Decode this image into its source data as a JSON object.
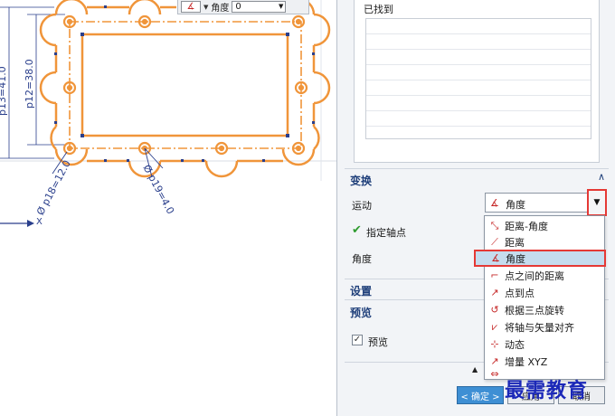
{
  "viewport": {
    "toolbar": {
      "icon": "angle-icon",
      "label": "角度",
      "value": "0"
    },
    "dimensions": {
      "left_partial": "p13=41.0",
      "vertical": "p12=38.0",
      "diag1": "Ø p18=12.0",
      "diag2": "Ø p19=4.0"
    },
    "axis_label": "X",
    "colors": {
      "sketch": "#f0953a",
      "dimension": "#2a3f8c",
      "accent": "#1f3f7a"
    }
  },
  "dialog": {
    "found_label": "已找到",
    "transform": {
      "title": "变换",
      "motion_label": "运动",
      "motion_value": "角度",
      "axis_point_label": "指定轴点",
      "angle_label": "角度",
      "options": [
        {
          "icon": "distance-angle-icon",
          "label": "距离-角度"
        },
        {
          "icon": "distance-icon",
          "label": "距离"
        },
        {
          "icon": "angle-icon",
          "label": "角度",
          "selected": true
        },
        {
          "icon": "between-points-icon",
          "label": "点之间的距离"
        },
        {
          "icon": "point-to-point-icon",
          "label": "点到点"
        },
        {
          "icon": "three-point-rotate-icon",
          "label": "根据三点旋转"
        },
        {
          "icon": "align-axis-vector-icon",
          "label": "将轴与矢量对齐"
        },
        {
          "icon": "dynamic-icon",
          "label": "动态"
        },
        {
          "icon": "increment-xyz-icon",
          "label": "增量 XYZ"
        },
        {
          "icon": "more-icon",
          "label": ""
        }
      ]
    },
    "settings": {
      "title": "设置"
    },
    "preview": {
      "title": "预览",
      "checkbox_label": "预览",
      "checked": true
    },
    "buttons": {
      "ok": "< 确定 >",
      "apply": "应用",
      "cancel": "取消"
    }
  },
  "watermark": "最需教育"
}
